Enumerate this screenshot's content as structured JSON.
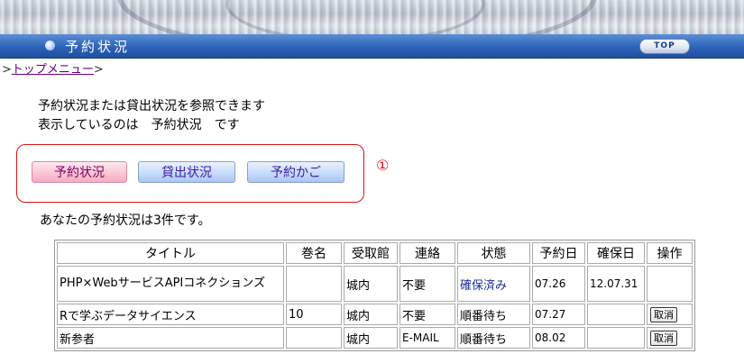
{
  "header": {
    "title": "予約状況",
    "top_button": "TOP"
  },
  "breadcrumb": {
    "prefix": ">",
    "link": "トップメニュー",
    "suffix": ">"
  },
  "intro": {
    "line1": "予約状況または貸出状況を参照できます",
    "line2": "表示しているのは　予約状況　です"
  },
  "tabs": [
    {
      "label": "予約状況"
    },
    {
      "label": "貸出状況"
    },
    {
      "label": "予約かご"
    }
  ],
  "annotation_marker": "①",
  "summary": "あなたの予約状況は3件です。",
  "table": {
    "headers": [
      "タイトル",
      "巻名",
      "受取館",
      "連絡",
      "状態",
      "予約日",
      "確保日",
      "操作"
    ],
    "rows": [
      {
        "title": "PHP×WebサービスAPIコネクションズ",
        "volume": "",
        "pickup": "城内",
        "contact": "不要",
        "status": "確保済み",
        "reserved": "07.26",
        "secured": "12.07.31",
        "action": ""
      },
      {
        "title": "Rで学ぶデータサイエンス",
        "volume": "10",
        "pickup": "城内",
        "contact": "不要",
        "status": "順番待ち",
        "reserved": "07.27",
        "secured": "",
        "action": "取消"
      },
      {
        "title": "新参者",
        "volume": "",
        "pickup": "城内",
        "contact": "E-MAIL",
        "status": "順番待ち",
        "reserved": "08.02",
        "secured": "",
        "action": "取消"
      }
    ]
  },
  "colors": {
    "title_bar": "#2d63b8",
    "link": "#6a0080",
    "box_border": "#dd1111",
    "status_secured": "#1a2fa0"
  }
}
